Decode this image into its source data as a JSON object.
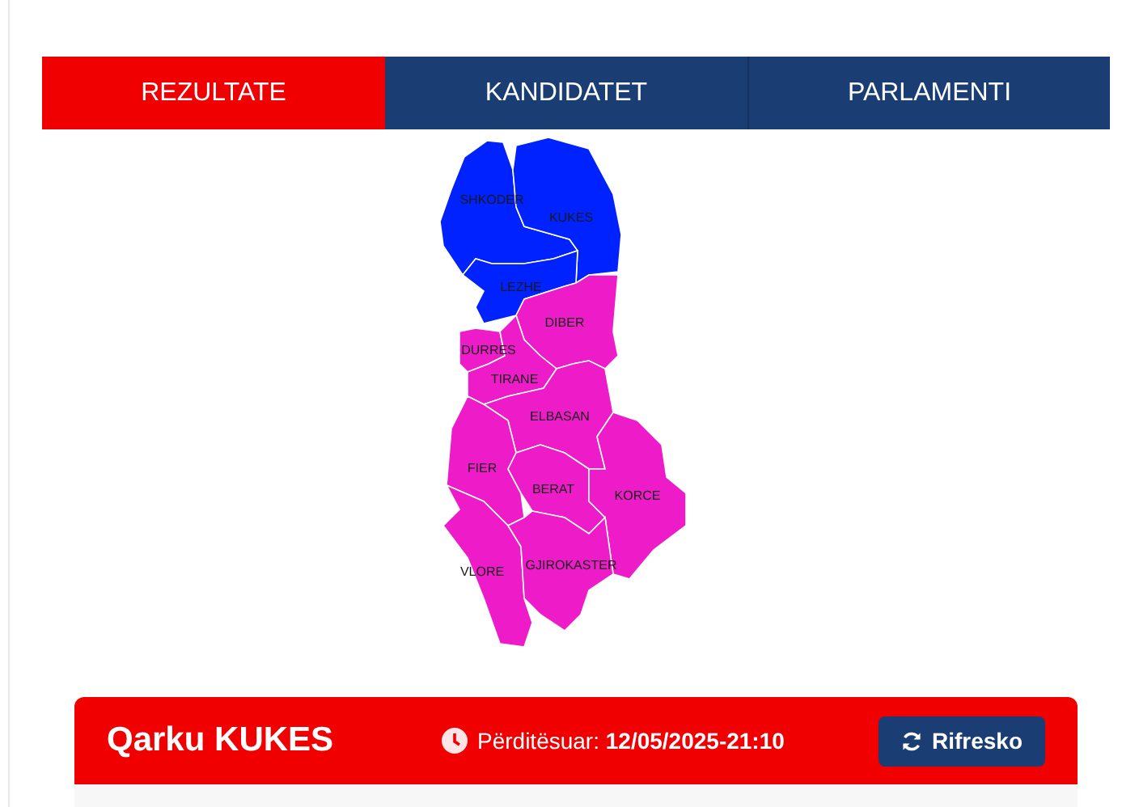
{
  "tabs": [
    {
      "label": "REZULTATE",
      "selected": true
    },
    {
      "label": "KANDIDATET",
      "selected": false
    },
    {
      "label": "PARLAMENTI",
      "selected": false
    }
  ],
  "map": {
    "regions": [
      {
        "name": "SHKODER",
        "color": "#0022ff"
      },
      {
        "name": "KUKES",
        "color": "#0022ff"
      },
      {
        "name": "LEZHE",
        "color": "#0022ff"
      },
      {
        "name": "DIBER",
        "color": "#ee1cc8"
      },
      {
        "name": "DURRES",
        "color": "#ee1cc8"
      },
      {
        "name": "TIRANE",
        "color": "#ee1cc8"
      },
      {
        "name": "ELBASAN",
        "color": "#ee1cc8"
      },
      {
        "name": "FIER",
        "color": "#ee1cc8"
      },
      {
        "name": "BERAT",
        "color": "#ee1cc8"
      },
      {
        "name": "KORCE",
        "color": "#ee1cc8"
      },
      {
        "name": "VLORE",
        "color": "#ee1cc8"
      },
      {
        "name": "GJIROKASTER",
        "color": "#ee1cc8"
      }
    ]
  },
  "card": {
    "title": "Qarku KUKES",
    "updated": "Përditësuar: **12/05/2025-21:10**",
    "button": "Rifresko"
  }
}
